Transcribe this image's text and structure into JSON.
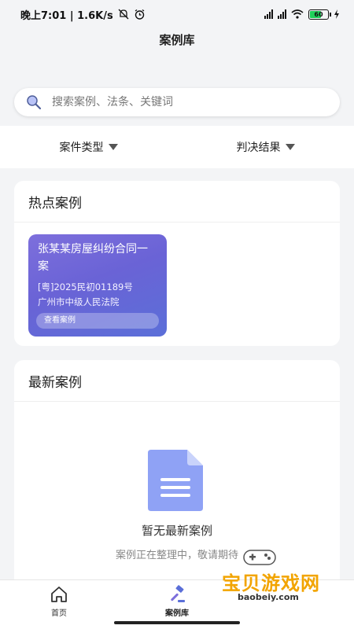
{
  "status_bar": {
    "time_text": "晚上7:01 | 1.6K/s",
    "battery": "60"
  },
  "header": {
    "title": "案例库"
  },
  "search": {
    "placeholder": "搜索案例、法条、关键词"
  },
  "filters": [
    {
      "label": "案件类型"
    },
    {
      "label": "判决结果"
    }
  ],
  "hot_cases": {
    "title": "热点案例",
    "items": [
      {
        "name": "张某某房屋纠纷合同一案",
        "case_number": "[粤]2025民初01189号",
        "court": "广州市中级人民法院",
        "action": "查看案例"
      }
    ]
  },
  "latest_cases": {
    "title": "最新案例",
    "empty_title": "暂无最新案例",
    "empty_subtitle": "案例正在整理中，敬请期待"
  },
  "bottom_nav": [
    {
      "label": "首页",
      "icon": "home-icon"
    },
    {
      "label": "案例库",
      "icon": "gavel-icon",
      "active": true
    },
    {
      "label": "",
      "icon": ""
    }
  ],
  "watermark": {
    "text": "宝贝游戏网",
    "url": "baobeiy.com"
  },
  "colors": {
    "accent": "#6a63d6",
    "doc_icon": "#8fa2f5",
    "watermark": "#f2a400"
  }
}
